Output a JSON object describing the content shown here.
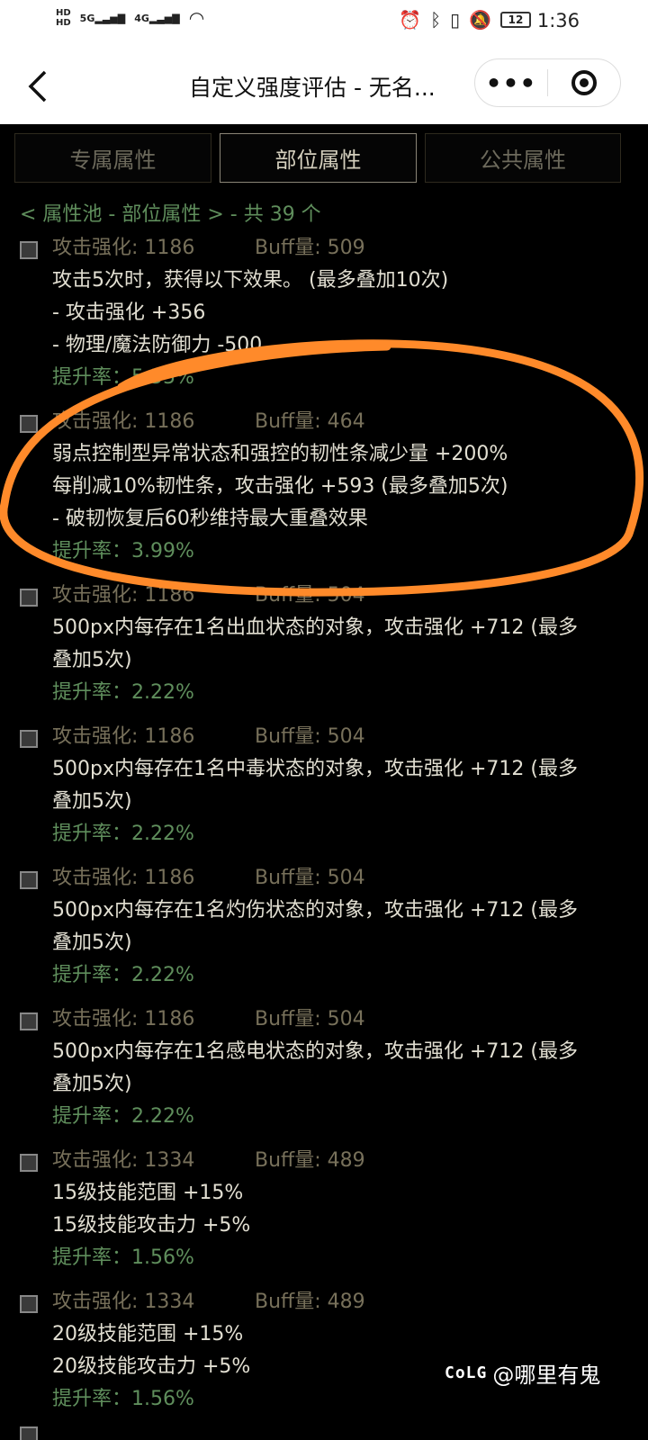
{
  "status": {
    "network_left": "HD 5G 46",
    "time": "1:36",
    "battery": "12"
  },
  "appbar": {
    "title": "自定义强度评估 - 无名...",
    "more_label": "•••"
  },
  "tabs": [
    {
      "label": "专属属性",
      "active": false
    },
    {
      "label": "部位属性",
      "active": true
    },
    {
      "label": "公共属性",
      "active": false
    }
  ],
  "pool_label": "< 属性池 - 部位属性 > - 共 39 个",
  "items": [
    {
      "atk": "攻击强化: 1186",
      "buff": "Buff量: 509",
      "lines": [
        "攻击5次时，获得以下效果。 (最多叠加10次)",
        "- 攻击强化 +356",
        "- 物理/魔法防御力 -500"
      ],
      "rate": "提升率：5.55%"
    },
    {
      "atk": "攻击强化: 1186",
      "buff": "Buff量: 464",
      "lines": [
        "弱点控制型异常状态和强控的韧性条减少量 +200%",
        "每削减10%韧性条，攻击强化 +593 (最多叠加5次)",
        "- 破韧恢复后60秒维持最大重叠效果"
      ],
      "rate": "提升率：3.99%"
    },
    {
      "atk": "攻击强化: 1186",
      "buff": "Buff量: 504",
      "lines": [
        "500px内每存在1名出血状态的对象，攻击强化 +712 (最多",
        "叠加5次)"
      ],
      "rate": "提升率：2.22%"
    },
    {
      "atk": "攻击强化: 1186",
      "buff": "Buff量: 504",
      "lines": [
        "500px内每存在1名中毒状态的对象，攻击强化 +712 (最多",
        "叠加5次)"
      ],
      "rate": "提升率：2.22%"
    },
    {
      "atk": "攻击强化: 1186",
      "buff": "Buff量: 504",
      "lines": [
        "500px内每存在1名灼伤状态的对象，攻击强化 +712 (最多",
        "叠加5次)"
      ],
      "rate": "提升率：2.22%"
    },
    {
      "atk": "攻击强化: 1186",
      "buff": "Buff量: 504",
      "lines": [
        "500px内每存在1名感电状态的对象，攻击强化 +712 (最多",
        "叠加5次)"
      ],
      "rate": "提升率：2.22%"
    },
    {
      "atk": "攻击强化: 1334",
      "buff": "Buff量: 489",
      "lines": [
        "15级技能范围 +15%",
        "15级技能攻击力 +5%"
      ],
      "rate": "提升率：1.56%"
    },
    {
      "atk": "攻击强化: 1334",
      "buff": "Buff量: 489",
      "lines": [
        "20级技能范围 +15%",
        "20级技能攻击力 +5%"
      ],
      "rate": "提升率：1.56%"
    }
  ],
  "watermark": {
    "logo": "CoLG",
    "user": "@哪里有鬼"
  },
  "colors": {
    "green": "#5f8e5c",
    "annotation": "#ff8a2a"
  }
}
